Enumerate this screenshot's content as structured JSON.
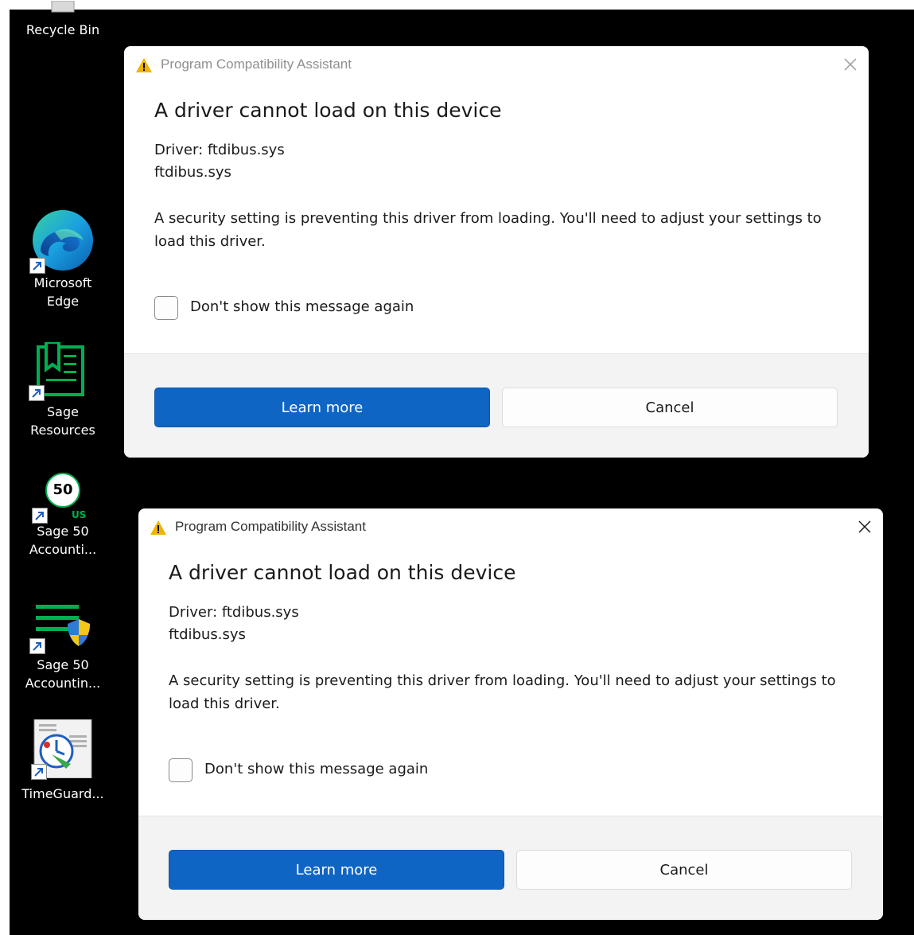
{
  "desktop": {
    "icons": [
      {
        "label": "Recycle Bin",
        "icon": "recycle-bin-icon"
      },
      {
        "label": "Microsoft\nEdge",
        "icon": "edge-icon"
      },
      {
        "label": "Sage\nResources",
        "icon": "sage-resources-icon"
      },
      {
        "label": "Sage 50\nAccounti...",
        "icon": "sage-50-us-icon",
        "badge_number": "50",
        "badge_region": "US"
      },
      {
        "label": "Sage 50\nAccountin...",
        "icon": "sage-50-shield-icon"
      },
      {
        "label": "TimeGuard...",
        "icon": "timeguard-icon"
      }
    ]
  },
  "dialogs": [
    {
      "state": "inactive",
      "title": "Program Compatibility Assistant",
      "heading": "A driver cannot load on this device",
      "driver_line_1": "Driver: ftdibus.sys",
      "driver_line_2": "ftdibus.sys",
      "message": "A security setting is preventing this driver from loading. You'll need to adjust your settings to load this driver.",
      "checkbox_label": "Don't show this message again",
      "checkbox_checked": false,
      "primary_button": "Learn more",
      "secondary_button": "Cancel"
    },
    {
      "state": "active",
      "title": "Program Compatibility Assistant",
      "heading": "A driver cannot load on this device",
      "driver_line_1": "Driver: ftdibus.sys",
      "driver_line_2": "ftdibus.sys",
      "message": "A security setting is preventing this driver from loading. You'll need to adjust your settings to load this driver.",
      "checkbox_label": "Don't show this message again",
      "checkbox_checked": false,
      "primary_button": "Learn more",
      "secondary_button": "Cancel"
    }
  ],
  "colors": {
    "desktop_background": "#000000",
    "primary_button": "#0f65c4",
    "warning_icon": "#f0b400",
    "footer_background": "#f3f3f3"
  }
}
